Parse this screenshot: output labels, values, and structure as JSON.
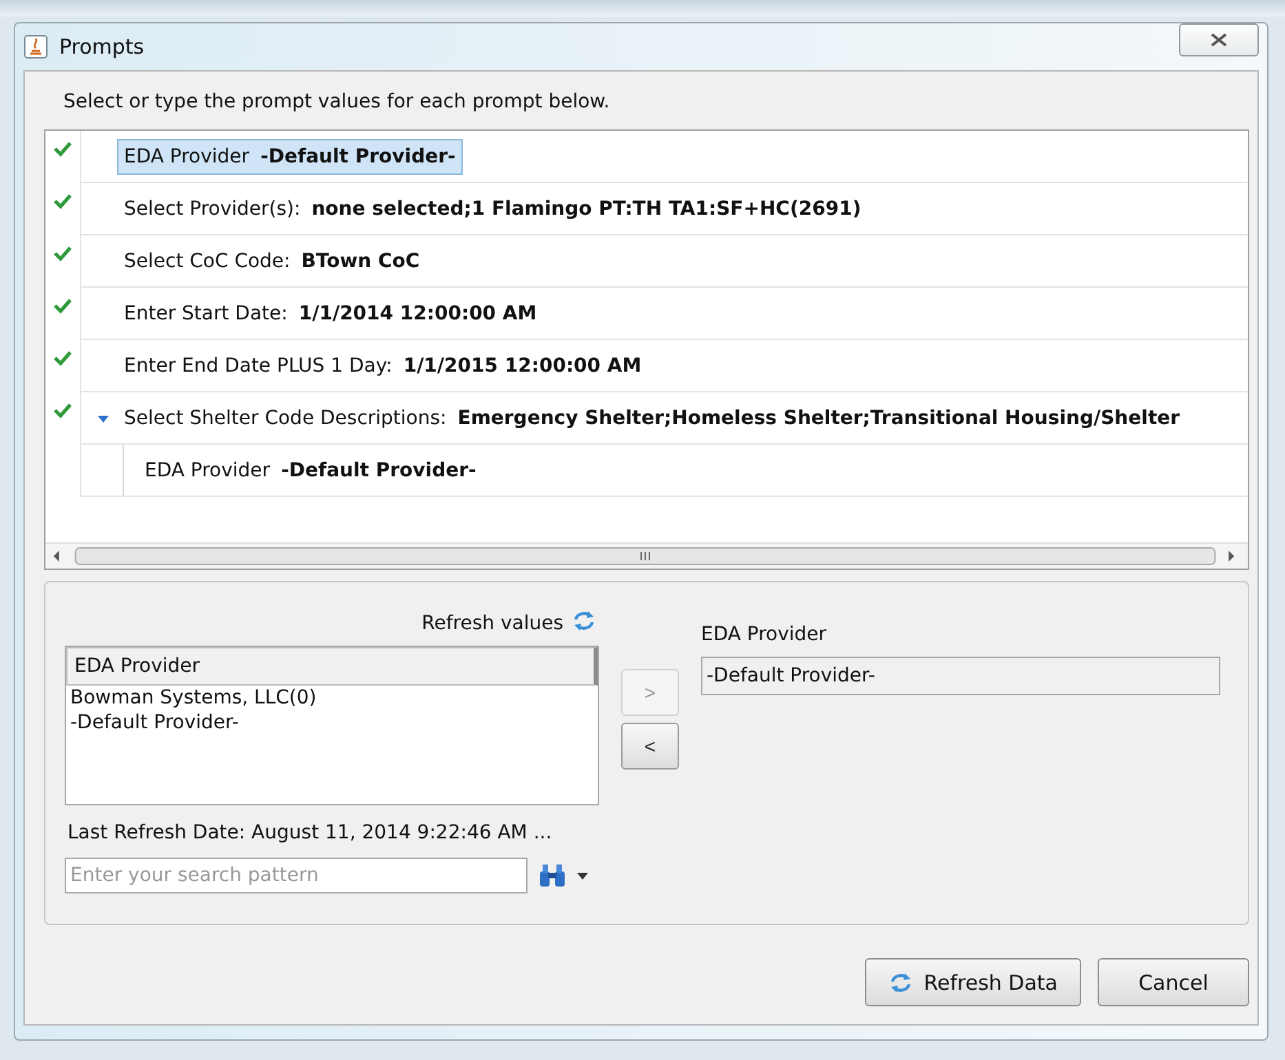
{
  "window": {
    "title": "Prompts"
  },
  "instruction": "Select or type the prompt values for each prompt below.",
  "prompts": [
    {
      "label": "EDA Provider",
      "value": "-Default Provider-",
      "done": true,
      "selected": true
    },
    {
      "label": "Select Provider(s):",
      "value": "none selected;1 Flamingo PT:TH TA1:SF+HC(2691)",
      "done": true,
      "selected": false
    },
    {
      "label": "Select CoC Code:",
      "value": "BTown CoC",
      "done": true,
      "selected": false
    },
    {
      "label": "Enter Start Date:",
      "value": "1/1/2014 12:00:00 AM",
      "done": true,
      "selected": false
    },
    {
      "label": "Enter End Date PLUS 1 Day:",
      "value": "1/1/2015 12:00:00 AM",
      "done": true,
      "selected": false
    },
    {
      "label": "Select Shelter Code Descriptions:",
      "value": "Emergency Shelter;Homeless Shelter;Transitional Housing/Shelter",
      "done": true,
      "selected": false,
      "expanded": true,
      "children": [
        {
          "label": "EDA Provider",
          "value": "-Default Provider-",
          "selected": false
        }
      ]
    }
  ],
  "values_panel": {
    "refresh_label": "Refresh values",
    "column": "EDA Provider",
    "items": [
      {
        "text": "Bowman Systems, LLC(0)",
        "selected": false
      },
      {
        "text": "-Default Provider-",
        "selected": false
      }
    ],
    "last_refresh": "Last Refresh Date: August 11, 2014 9:22:46 AM ...",
    "search": {
      "placeholder": "Enter your search pattern"
    }
  },
  "move_buttons": [
    {
      "label": ">",
      "disabled": true
    },
    {
      "label": "<",
      "disabled": false
    }
  ],
  "selected_panel": {
    "title": "EDA Provider",
    "values": [
      "-Default Provider-"
    ]
  },
  "buttons": [
    {
      "label": "Refresh Data",
      "kind": "refresh"
    },
    {
      "label": "Cancel",
      "kind": "plain"
    }
  ]
}
